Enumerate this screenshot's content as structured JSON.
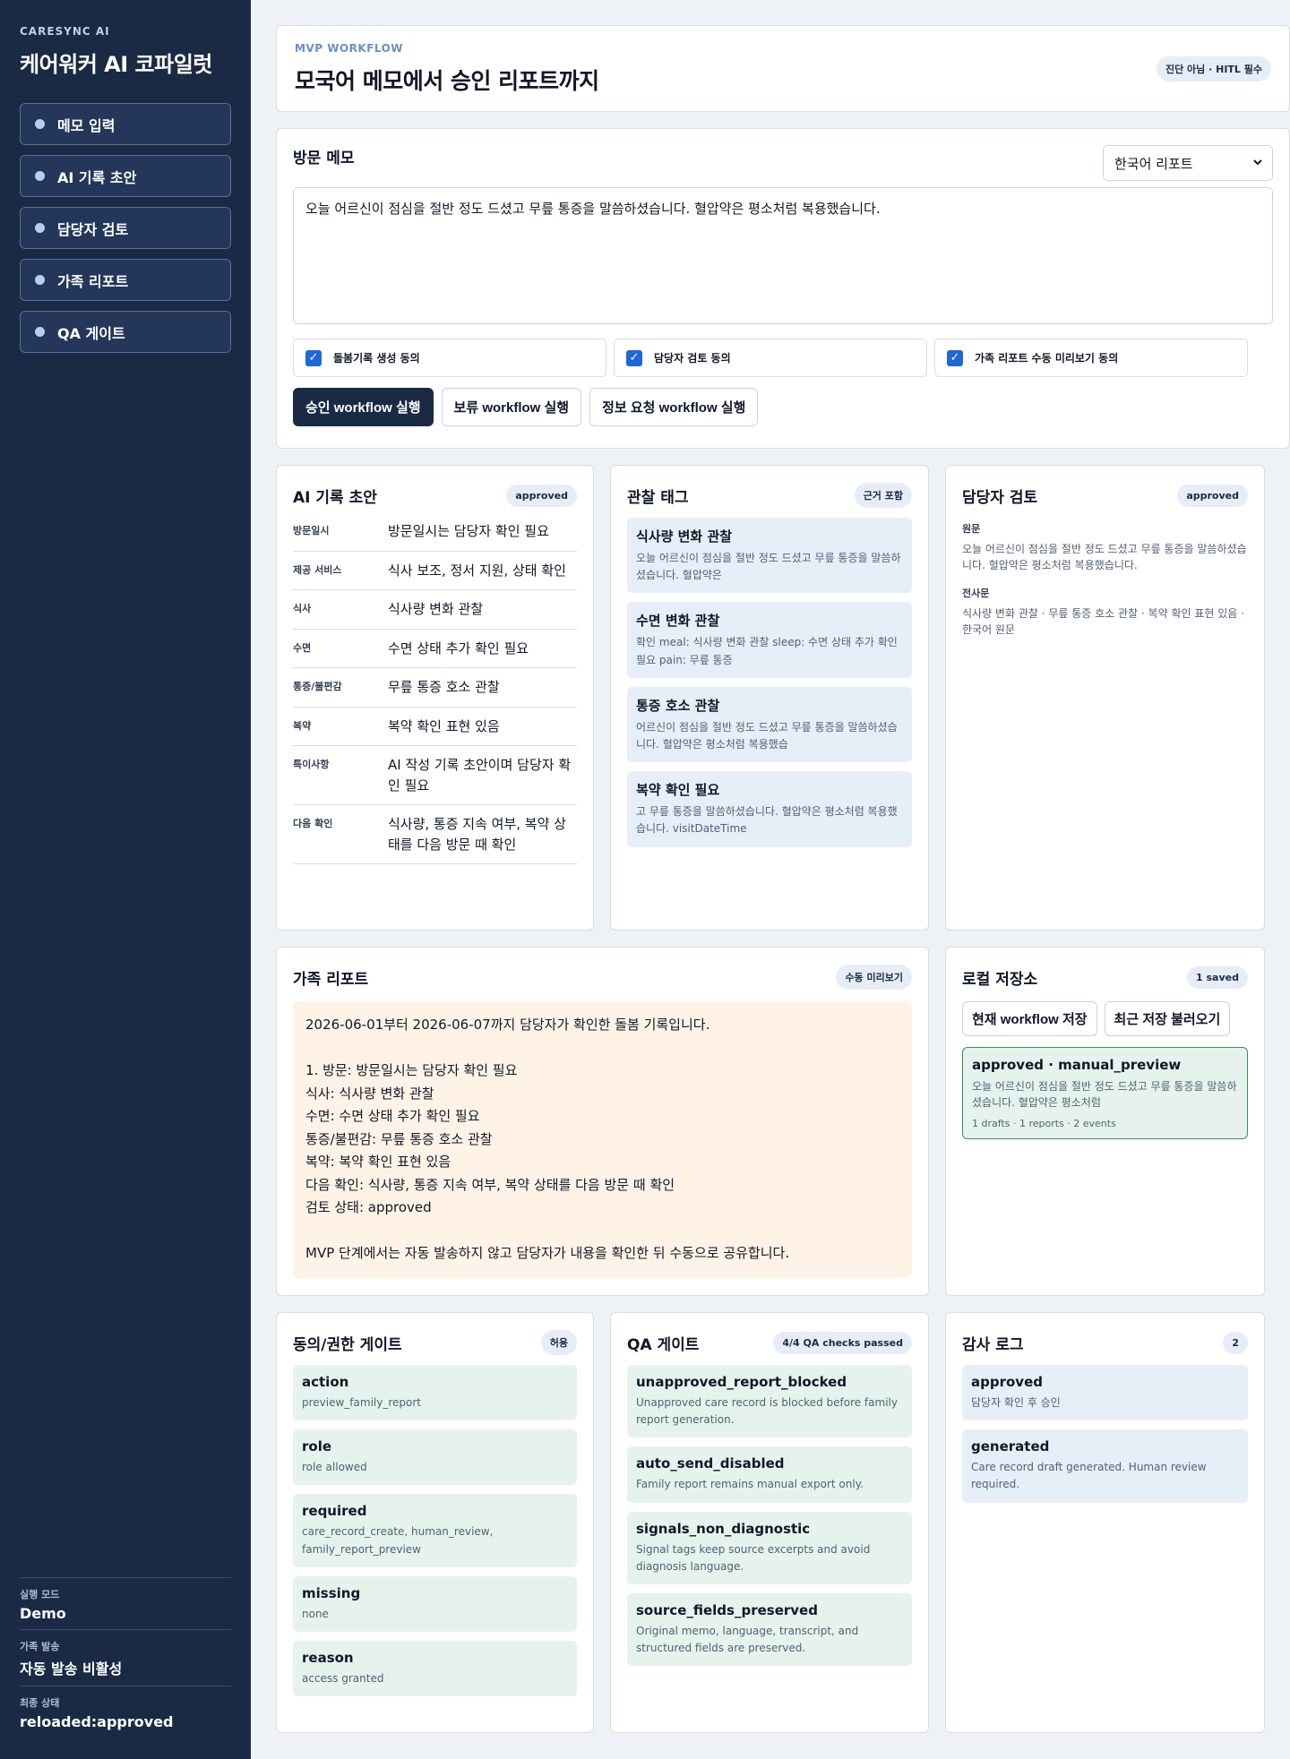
{
  "sidebar": {
    "brand_sub": "CARESYNC AI",
    "brand_title": "케어워커 AI 코파일럿",
    "nav": [
      "메모 입력",
      "AI 기록 초안",
      "담당자 검토",
      "가족 리포트",
      "QA 게이트"
    ],
    "stats": [
      {
        "label": "실행 모드",
        "value": "Demo"
      },
      {
        "label": "가족 발송",
        "value": "자동 발송 비활성"
      },
      {
        "label": "최종 상태",
        "value": "reloaded:approved"
      }
    ]
  },
  "hero": {
    "sub": "MVP WORKFLOW",
    "title": "모국어 메모에서 승인 리포트까지",
    "badge": "진단 아님 · HITL 필수"
  },
  "memo": {
    "title": "방문 메모",
    "language_select": "한국어 리포트",
    "text": "오늘 어르신이 점심을 절반 정도 드셨고 무릎 통증을 말씀하셨습니다. 혈압약은 평소처럼 복용했습니다.",
    "consents": [
      "돌봄기록 생성 동의",
      "담당자 검토 동의",
      "가족 리포트 수동 미리보기 동의"
    ],
    "buttons": {
      "approve": "승인 workflow 실행",
      "hold": "보류 workflow 실행",
      "info": "정보 요청 workflow 실행"
    }
  },
  "draft": {
    "title": "AI 기록 초안",
    "badge": "approved",
    "rows": [
      {
        "label": "방문일시",
        "value": "방문일시는 담당자 확인 필요"
      },
      {
        "label": "제공 서비스",
        "value": "식사 보조, 정서 지원, 상태 확인"
      },
      {
        "label": "식사",
        "value": "식사량 변화 관찰"
      },
      {
        "label": "수면",
        "value": "수면 상태 추가 확인 필요"
      },
      {
        "label": "통증/불편감",
        "value": "무릎 통증 호소 관찰"
      },
      {
        "label": "복약",
        "value": "복약 확인 표현 있음"
      },
      {
        "label": "특이사항",
        "value": "AI 작성 기록 초안이며 담당자 확인 필요"
      },
      {
        "label": "다음 확인",
        "value": "식사량, 통증 지속 여부, 복약 상태를 다음 방문 때 확인"
      }
    ]
  },
  "tags": {
    "title": "관찰 태그",
    "badge": "근거 포함",
    "items": [
      {
        "title": "식사량 변화 관찰",
        "text": "오늘 어르신이 점심을 절반 정도 드셨고 무릎 통증을 말씀하셨습니다. 혈압약은"
      },
      {
        "title": "수면 변화 관찰",
        "text": "확인 meal: 식사량 변화 관찰 sleep: 수면 상태 추가 확인 필요 pain: 무릎 통증"
      },
      {
        "title": "통증 호소 관찰",
        "text": "어르신이 점심을 절반 정도 드셨고 무릎 통증을 말씀하셨습니다. 혈압약은 평소처럼 복용했습"
      },
      {
        "title": "복약 확인 필요",
        "text": "고 무릎 통증을 말씀하셨습니다. 혈압약은 평소처럼 복용했습니다. visitDateTime"
      }
    ]
  },
  "review": {
    "title": "담당자 검토",
    "badge": "approved",
    "original_label": "원문",
    "original": "오늘 어르신이 점심을 절반 정도 드셨고 무릎 통증을 말씀하셨습니다. 혈압약은 평소처럼 복용했습니다.",
    "transcript_label": "전사문",
    "transcript": "식사량 변화 관찰 · 무릎 통증 호소 관찰 · 복약 확인 표현 있음 · 한국어 원문"
  },
  "report": {
    "title": "가족 리포트",
    "badge": "수동 미리보기",
    "body": "2026-06-01부터 2026-06-07까지 담당자가 확인한 돌봄 기록입니다.\n\n1. 방문: 방문일시는 담당자 확인 필요\n식사: 식사량 변화 관찰\n수면: 수면 상태 추가 확인 필요\n통증/불편감: 무릎 통증 호소 관찰\n복약: 복약 확인 표현 있음\n다음 확인: 식사량, 통증 지속 여부, 복약 상태를 다음 방문 때 확인\n검토 상태: approved\n\nMVP 단계에서는 자동 발송하지 않고 담당자가 내용을 확인한 뒤 수동으로 공유합니다."
  },
  "storage": {
    "title": "로컬 저장소",
    "badge": "1 saved",
    "save_btn": "현재 workflow 저장",
    "load_btn": "최근 저장 불러오기",
    "saved_title": "approved · manual_preview",
    "saved_text": "오늘 어르신이 점심을 절반 정도 드셨고 무릎 통증을 말씀하셨습니다. 혈압약은 평소처럼",
    "saved_meta": "1 drafts · 1 reports · 2 events"
  },
  "consent_gate": {
    "title": "동의/권한 게이트",
    "badge": "허용",
    "items": [
      {
        "title": "action",
        "text": "preview_family_report"
      },
      {
        "title": "role",
        "text": "role allowed"
      },
      {
        "title": "required",
        "text": "care_record_create, human_review, family_report_preview"
      },
      {
        "title": "missing",
        "text": "none"
      },
      {
        "title": "reason",
        "text": "access granted"
      }
    ]
  },
  "qa_gate": {
    "title": "QA 게이트",
    "badge": "4/4 QA checks passed",
    "items": [
      {
        "title": "unapproved_report_blocked",
        "text": "Unapproved care record is blocked before family report generation."
      },
      {
        "title": "auto_send_disabled",
        "text": "Family report remains manual export only."
      },
      {
        "title": "signals_non_diagnostic",
        "text": "Signal tags keep source excerpts and avoid diagnosis language."
      },
      {
        "title": "source_fields_preserved",
        "text": "Original memo, language, transcript, and structured fields are preserved."
      }
    ]
  },
  "audit": {
    "title": "감사 로그",
    "badge": "2",
    "items": [
      {
        "title": "approved",
        "text": "담당자 확인 후 승인"
      },
      {
        "title": "generated",
        "text": "Care record draft generated. Human review required."
      }
    ]
  }
}
